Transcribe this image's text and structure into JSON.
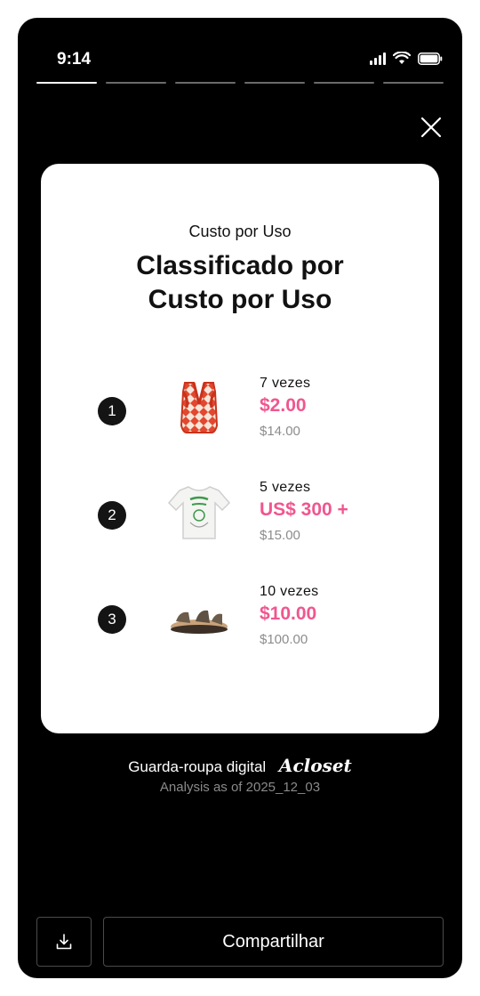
{
  "status_bar": {
    "time": "9:14",
    "icons": [
      "signal-icon",
      "wifi-icon",
      "battery-icon"
    ]
  },
  "story_progress": {
    "total": 6,
    "active_index": 0
  },
  "card": {
    "subtitle": "Custo por Uso",
    "title_line1": "Classificado por",
    "title_line2": "Custo por Uso",
    "items": [
      {
        "rank": "1",
        "image": "knit-vest",
        "uses": "7 vezes",
        "cost": "$2.00",
        "price": "$14.00"
      },
      {
        "rank": "2",
        "image": "graphic-tshirt",
        "uses": "5 vezes",
        "cost": "US$ 300 +",
        "price": "$15.00"
      },
      {
        "rank": "3",
        "image": "sandals",
        "uses": "10 vezes",
        "cost": "$10.00",
        "price": "$100.00"
      }
    ]
  },
  "footer": {
    "label": "Guarda-roupa digital",
    "brand": "Acloset",
    "analysis": "Analysis as of 2025_12_03"
  },
  "actions": {
    "share_label": "Compartilhar",
    "download_icon": "download-icon"
  },
  "colors": {
    "accent_pink": "#f0568f",
    "background": "#000000",
    "card": "#ffffff"
  }
}
